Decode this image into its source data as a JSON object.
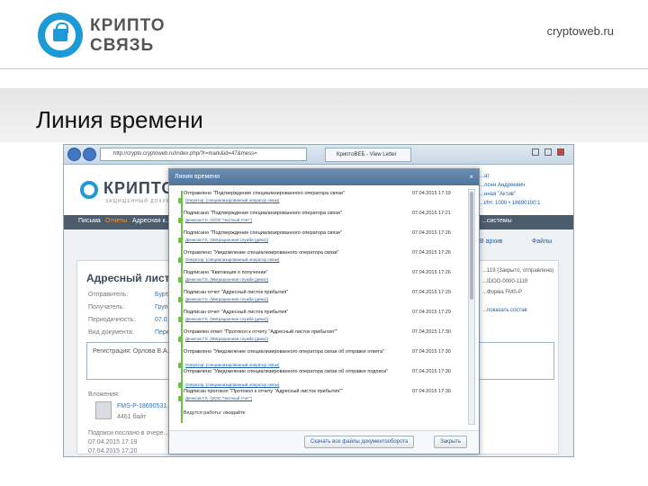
{
  "slide": {
    "logo_line1": "КРИПТО",
    "logo_line2": "СВЯЗЬ",
    "site": "cryptoweb.ru",
    "title": "Линия времени"
  },
  "browser": {
    "address": "http://crypto.cryptoweb.ru/index.php/?r=mark&id=47&mess=",
    "tab_label": "КриптоВЕБ - View Letter"
  },
  "app": {
    "logo": "КРИПТО",
    "logo_sub": "ЗАЩИЩЕННЫЙ ДОКУМЕНТ",
    "user_lines": [
      "...ат",
      "...лсен Андреевич",
      "...нная \"Актив\"",
      "...ИН: 1000 • 18690100:1"
    ],
    "nav": [
      {
        "label": "Письма",
        "active": false
      },
      {
        "label": "Отчеты",
        "active": true
      },
      {
        "label": "Адресная к...",
        "active": false
      },
      {
        "label": "...системы",
        "active": false
      }
    ],
    "toolbar_right": [
      "В архив",
      "Файлы"
    ],
    "doc_title": "Адресный листо...",
    "fields": [
      {
        "label": "Отправитель:",
        "value": "Бурт..."
      },
      {
        "label": "Получатель:",
        "value": "Груп..."
      },
      {
        "label": "Периодичность:",
        "value": "07.0..."
      },
      {
        "label": "Вид документа:",
        "value": "Пере..."
      }
    ],
    "right_info": [
      "...119 (Закрыто, отправлено)",
      "...IDOO-0000-1119",
      "...Форма FMS-P",
      "...показать состав"
    ],
    "reg_text": "Регистрация: Орлова В.А.",
    "attach_label": "Вложения:",
    "attach_file": "FMS-P-18690531...",
    "attach_size": "4461 байт",
    "bottom_label": "Подписи послано в очере...",
    "bottom_dates": [
      "07.04.2015 17:19",
      "07.04.2015 17:20"
    ]
  },
  "modal": {
    "title": "Линия времени",
    "close": "×",
    "entries": [
      {
        "title": "Отправлено \"Подтверждение специализированного оператора связи\"",
        "sub": "Оператор: (специализированный оператор связи)",
        "date": "07.04.2015 17:19"
      },
      {
        "title": "Подписано \"Подтверждение специализированного оператора связи\"",
        "sub": "Денисов Г.К. (ООО \"Честный Учет\")",
        "date": "07.04.2015 17:21"
      },
      {
        "title": "Подписано \"Подтверждение специализированного оператора связи\"",
        "sub": "Денисов Г.К. (Миграционная служба (демо))",
        "date": "07.04.2015 17:26"
      },
      {
        "title": "Отправлено \"Уведомление специализированного оператора связи\"",
        "sub": "Оператор: (специализированный оператор связи)",
        "date": "07.04.2015 17:26"
      },
      {
        "title": "Подписано \"Квитанция о получении\"",
        "sub": "Денисов Г.К. (Миграционная служба (демо))",
        "date": "07.04.2015 17:26"
      },
      {
        "title": "Подписан отчет \"Адресный листок прибытия\"",
        "sub": "Денисов Г.К. (Миграционная служба (демо))",
        "date": "07.04.2015 17:29"
      },
      {
        "title": "Подписан отчет \"Адресный листок прибытия\"",
        "sub": "Денисов Г.К. (Миграционная служба (демо))",
        "date": "07.04.2015 17:29"
      },
      {
        "title": "Отправлен ответ \"Протокол к отчету \"Адресный листок прибытия\"\"",
        "sub": "Денисов Г.К. (Миграционная служба (демо))",
        "date": "07.04.2015 17:30"
      },
      {
        "title": "Отправлено \"Уведомление специализированного оператора связи об отправке ответа\"",
        "sub": "Оператор: (специализированный оператор связи)",
        "date": "07.04.2015 17:30"
      },
      {
        "title": "Отправлено \"Уведомление специализированного оператора связи об отправке подписи\"",
        "sub": "Оператор: (специализированный оператор связи)",
        "date": "07.04.2015 17:30"
      },
      {
        "title": "Подписан протокол \"Протокол к отчету \"Адресный листок прибытия\"\"",
        "sub": "Денисов Г.К. (ООО \"Честный Учет\")",
        "date": "07.04.2015 17:30"
      }
    ],
    "final": "Ведутся работы: ожидайте",
    "btn_download": "Скачать все файлы документооборота",
    "btn_close": "Закрыть"
  }
}
